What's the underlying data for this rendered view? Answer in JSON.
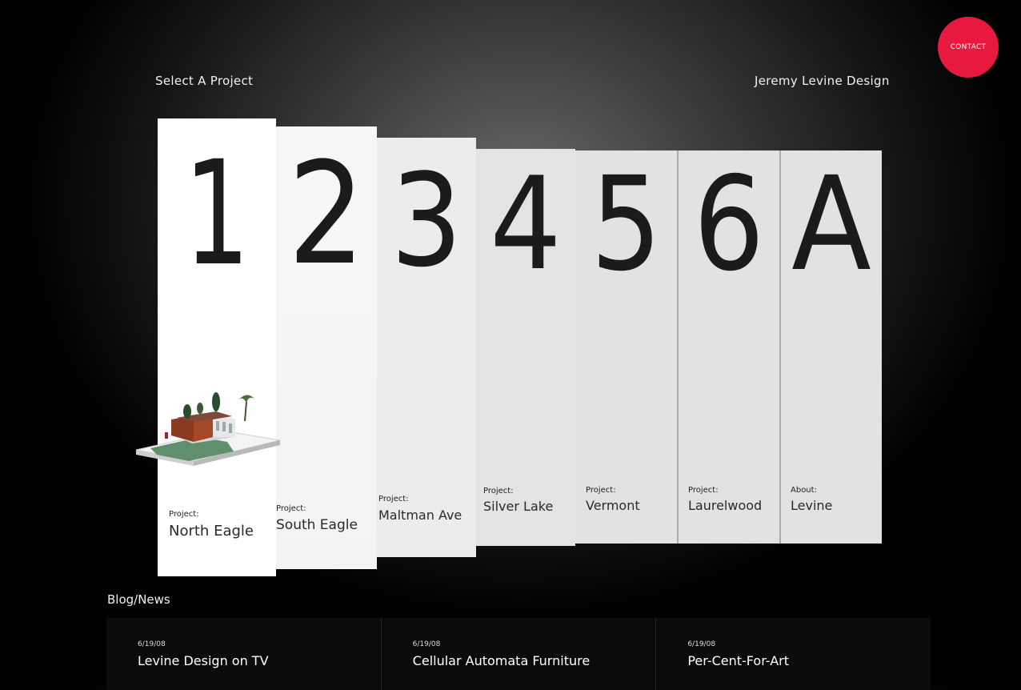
{
  "header": {
    "select_label": "Select A Project",
    "brand": "Jeremy Levine Design",
    "contact_label": "CONTACT",
    "contact_color": "#e8193f"
  },
  "cards": [
    {
      "numeral": "1",
      "caption": "Project:",
      "name": "North Eagle"
    },
    {
      "numeral": "2",
      "caption": "Project:",
      "name": "South Eagle"
    },
    {
      "numeral": "3",
      "caption": "Project:",
      "name": "Maltman Ave"
    },
    {
      "numeral": "4",
      "caption": "Project:",
      "name": "Silver Lake"
    },
    {
      "numeral": "5",
      "caption": "Project:",
      "name": "Vermont"
    },
    {
      "numeral": "6",
      "caption": "Project:",
      "name": "Laurelwood"
    },
    {
      "numeral": "A",
      "caption": "About:",
      "name": "Levine"
    }
  ],
  "blog": {
    "title": "Blog/News",
    "posts": [
      {
        "date": "6/19/08",
        "headline": "Levine Design on TV"
      },
      {
        "date": "6/19/08",
        "headline": "Cellular Automata Furniture"
      },
      {
        "date": "6/19/08",
        "headline": "Per-Cent-For-Art"
      }
    ]
  }
}
